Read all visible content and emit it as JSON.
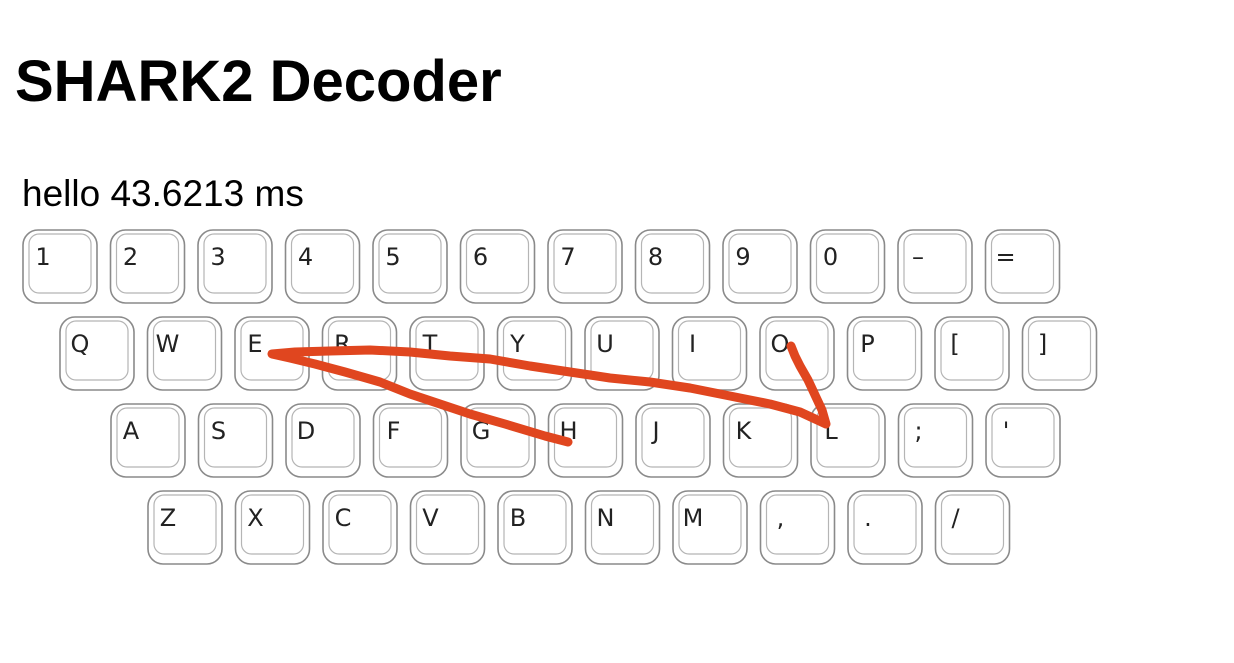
{
  "page": {
    "title": "SHARK2 Decoder",
    "result_word": "hello",
    "result_time": "43.6213",
    "result_unit": "ms"
  },
  "keyboard": {
    "rows": [
      [
        "1",
        "2",
        "3",
        "4",
        "5",
        "6",
        "7",
        "8",
        "9",
        "0",
        "–",
        "="
      ],
      [
        "Q",
        "W",
        "E",
        "R",
        "T",
        "Y",
        "U",
        "I",
        "O",
        "P",
        "[",
        "]"
      ],
      [
        "A",
        "S",
        "D",
        "F",
        "G",
        "H",
        "J",
        "K",
        "L",
        ";",
        "'"
      ],
      [
        "Z",
        "X",
        "C",
        "V",
        "B",
        "N",
        "M",
        ",",
        ".",
        "/"
      ]
    ]
  },
  "gesture": {
    "color": "#e0461f",
    "path_keys": [
      "H",
      "E",
      "L",
      "O"
    ]
  }
}
